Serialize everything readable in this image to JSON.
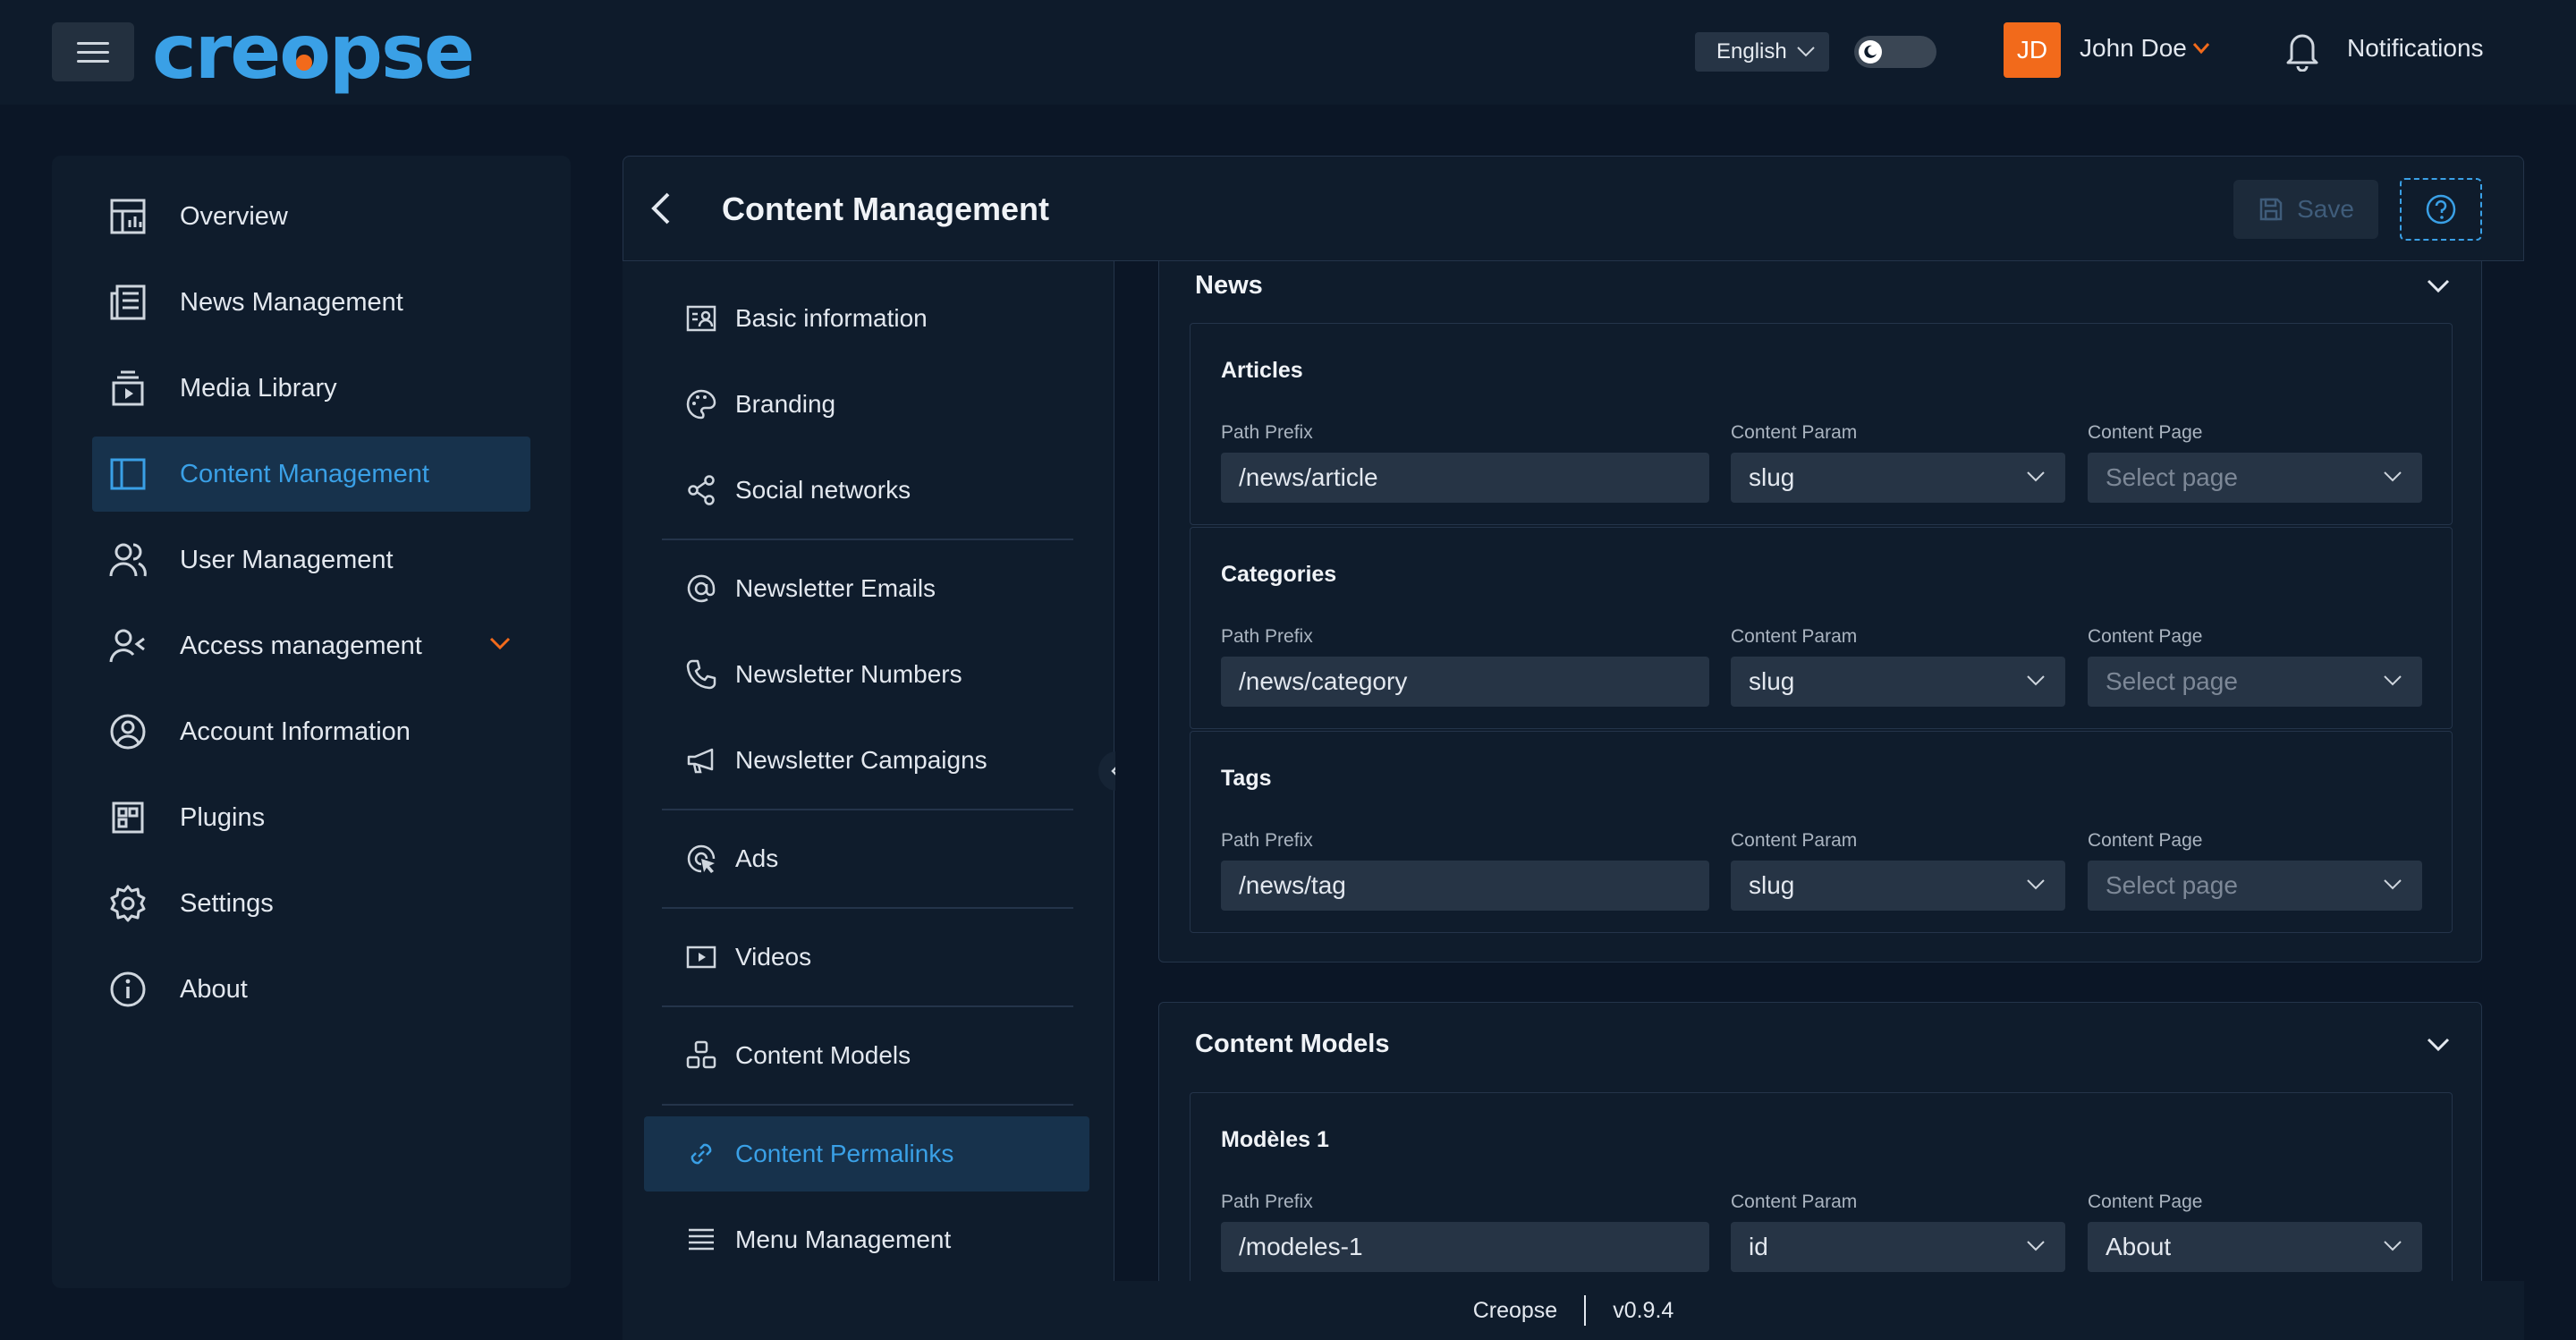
{
  "app": {
    "logo_text": "creopse",
    "brand_color": "#3aa0e6",
    "accent_color": "#f26a1b"
  },
  "header": {
    "language": "English",
    "theme_toggle": "moon-icon",
    "avatar_initials": "JD",
    "username": "John Doe",
    "notifications_label": "Notifications"
  },
  "sidebar": {
    "items": [
      {
        "label": "Overview",
        "icon": "dashboard-icon"
      },
      {
        "label": "News Management",
        "icon": "newspaper-icon"
      },
      {
        "label": "Media Library",
        "icon": "media-icon"
      },
      {
        "label": "Content Management",
        "icon": "layout-icon",
        "active": true
      },
      {
        "label": "User Management",
        "icon": "users-icon"
      },
      {
        "label": "Access management",
        "icon": "user-access-icon",
        "expandable": true
      },
      {
        "label": "Account Information",
        "icon": "account-icon"
      },
      {
        "label": "Plugins",
        "icon": "plugins-icon"
      },
      {
        "label": "Settings",
        "icon": "gear-icon"
      },
      {
        "label": "About",
        "icon": "info-icon"
      }
    ]
  },
  "page": {
    "title": "Content Management",
    "save_label": "Save"
  },
  "subnav": {
    "items": [
      {
        "label": "Basic information",
        "icon": "id-card-icon"
      },
      {
        "label": "Branding",
        "icon": "palette-icon"
      },
      {
        "label": "Social networks",
        "icon": "share-icon"
      },
      {
        "label": "Newsletter Emails",
        "icon": "at-icon"
      },
      {
        "label": "Newsletter Numbers",
        "icon": "phone-icon"
      },
      {
        "label": "Newsletter Campaigns",
        "icon": "megaphone-icon"
      },
      {
        "label": "Ads",
        "icon": "ads-icon"
      },
      {
        "label": "Videos",
        "icon": "video-icon"
      },
      {
        "label": "Content Models",
        "icon": "models-icon"
      },
      {
        "label": "Content Permalinks",
        "icon": "link-icon",
        "active": true
      },
      {
        "label": "Menu Management",
        "icon": "menu-icon"
      }
    ]
  },
  "labels": {
    "path_prefix": "Path Prefix",
    "content_param": "Content Param",
    "content_page": "Content Page"
  },
  "sections": {
    "news": {
      "title": "News",
      "cards": [
        {
          "title": "Articles",
          "path_prefix": "/news/article",
          "content_param": "slug",
          "content_page": "Select page"
        },
        {
          "title": "Categories",
          "path_prefix": "/news/category",
          "content_param": "slug",
          "content_page": "Select page"
        },
        {
          "title": "Tags",
          "path_prefix": "/news/tag",
          "content_param": "slug",
          "content_page": "Select page"
        }
      ]
    },
    "content_models": {
      "title": "Content Models",
      "cards": [
        {
          "title": "Modèles 1",
          "path_prefix": "/modeles-1",
          "content_param": "id",
          "content_page": "About"
        }
      ]
    }
  },
  "footer": {
    "app_name": "Creopse",
    "version": "v0.9.4"
  }
}
